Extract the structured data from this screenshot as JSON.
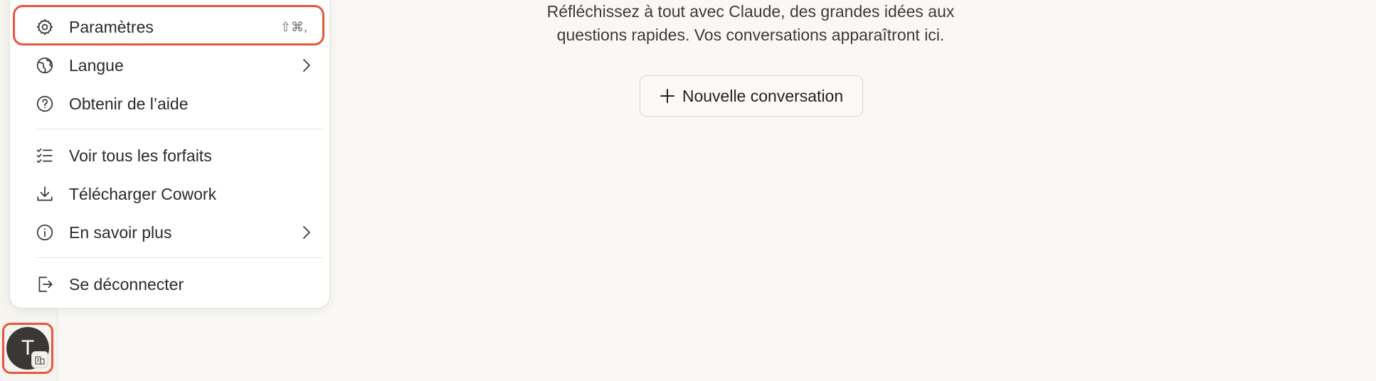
{
  "menu": {
    "items": [
      {
        "label": "Paramètres",
        "icon": "gear-icon",
        "shortcut": "⇧⌘,"
      },
      {
        "label": "Langue",
        "icon": "globe-icon",
        "submenu": true
      },
      {
        "label": "Obtenir de l’aide",
        "icon": "help-circle-icon"
      },
      {
        "label": "Voir tous les forfaits",
        "icon": "checklist-icon"
      },
      {
        "label": "Télécharger Cowork",
        "icon": "download-icon"
      },
      {
        "label": "En savoir plus",
        "icon": "info-icon",
        "submenu": true
      },
      {
        "label": "Se déconnecter",
        "icon": "logout-icon"
      }
    ]
  },
  "main": {
    "intro_line1": "Réfléchissez à tout avec Claude, des grandes idées aux",
    "intro_line2": "questions rapides. Vos conversations apparaîtront ici.",
    "new_conversation_label": "Nouvelle conversation"
  },
  "user": {
    "avatar_initial": "T"
  },
  "colors": {
    "highlight": "#e8553d",
    "background": "#f9f8f5",
    "avatar": "#3a3834"
  }
}
